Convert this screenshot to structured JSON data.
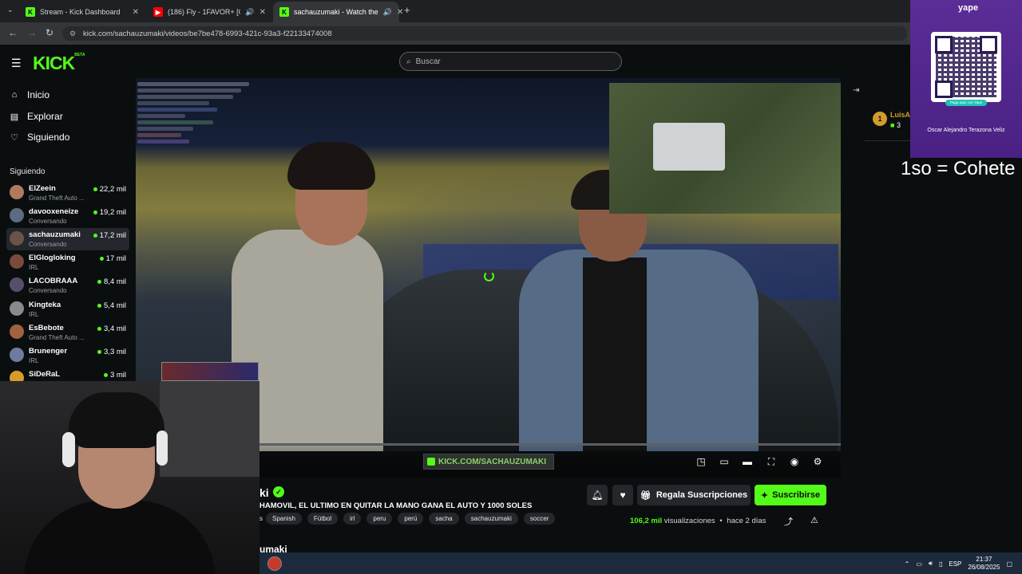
{
  "browser": {
    "tabs": [
      {
        "title": "Stream - Kick Dashboard",
        "favicon": "kick-icon",
        "active": false
      },
      {
        "title": "(186) Fly - 1FAVOR+ [Offici",
        "favicon": "youtube-icon",
        "active": false
      },
      {
        "title": "sachauzumaki - Watch the",
        "favicon": "kick-icon",
        "active": true
      }
    ],
    "url": "kick.com/sachauzumaki/videos/be7be478-6993-421c-93a3-f22133474008"
  },
  "header": {
    "logo_text": "KICK",
    "logo_badge": "BETA",
    "search_placeholder": "Buscar"
  },
  "nav": [
    {
      "label": "Inicio",
      "icon": "home-icon"
    },
    {
      "label": "Explorar",
      "icon": "compass-icon"
    },
    {
      "label": "Siguiendo",
      "icon": "heart-icon"
    }
  ],
  "sidebar": {
    "heading": "Siguiendo",
    "channels": [
      {
        "name": "ElZeein",
        "category": "Grand Theft Auto ...",
        "viewers": "22,2 mil",
        "color": "#b07a5e"
      },
      {
        "name": "davooxeneize",
        "category": "Conversando",
        "viewers": "19,2 mil",
        "color": "#5b6b80"
      },
      {
        "name": "sachauzumaki",
        "category": "Conversando",
        "viewers": "17,2 mil",
        "color": "#6a5448"
      },
      {
        "name": "ElGlogloking",
        "category": "IRL",
        "viewers": "17 mil",
        "color": "#7a4a3a"
      },
      {
        "name": "LACOBRAAA",
        "category": "Conversando",
        "viewers": "8,4 mil",
        "color": "#574e6e"
      },
      {
        "name": "Kingteka",
        "category": "IRL",
        "viewers": "5,4 mil",
        "color": "#8a8a8a"
      },
      {
        "name": "EsBebote",
        "category": "Grand Theft Auto ...",
        "viewers": "3,4 mil",
        "color": "#a0623f"
      },
      {
        "name": "Brunenger",
        "category": "IRL",
        "viewers": "3,3 mil",
        "color": "#6e7aa0"
      },
      {
        "name": "SiDeRaL",
        "category": "",
        "viewers": "3 mil",
        "color": "#d89a2a"
      }
    ]
  },
  "video": {
    "watermark": "KICK.COM/SACHAUZUMAKI",
    "controls": [
      "pip-icon",
      "theater-icon",
      "miniplayer-icon",
      "fullscreen-icon",
      "autoplay-icon",
      "settings-icon"
    ]
  },
  "channel": {
    "name_fragment": "ki",
    "title": "HAMOVIL, EL ULTIMO EN QUITAR LA MANO GANA EL AUTO Y 1000 SOLES",
    "tags": [
      "s",
      "Spanish",
      "Fútbol",
      "irl",
      "peru",
      "perú",
      "sacha",
      "sachauzumaki",
      "soccer"
    ],
    "gift_label": "Regala Suscripciones",
    "subscribe_label": "Suscribirse",
    "views_number": "106,2 mil",
    "views_label": "visualizaciones",
    "separator": "•",
    "age": "hace 2 días",
    "bottom_name": "umaki"
  },
  "chat": {
    "leader_rank": "1",
    "leader_name": "LuisAp",
    "leader_count": "3"
  },
  "overlay": {
    "qr_brand": "yape",
    "qr_pill": "Paga aquí con Yape",
    "qr_name": "Oscar Alejandro Terazona Veliz",
    "cohete_text": "1so = Cohete"
  },
  "taskbar": {
    "lang": "ESP",
    "time": "21:37",
    "date": "26/08/2025"
  },
  "colors": {
    "accent": "#53fc18",
    "background": "#0b0e0f",
    "yape_purple": "#5a2d97"
  }
}
